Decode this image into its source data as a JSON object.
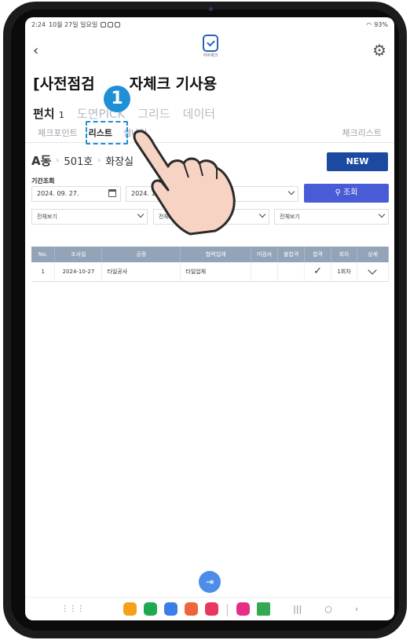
{
  "status": {
    "time": "2:24",
    "date": "10월 27일 일요일",
    "battery": "93%"
  },
  "app": {
    "logo_text": "하자체크",
    "title_visible": "[사전점검",
    "title_rest": "자체크 기사용"
  },
  "tabs_primary": [
    {
      "label": "펀치",
      "count": "1",
      "active": true
    },
    {
      "label": "도면PICK",
      "active": false
    },
    {
      "label": "그리드",
      "active": false
    },
    {
      "label": "데이터",
      "active": false
    }
  ],
  "tabs_secondary": {
    "items": [
      "체크포인트",
      "리스트",
      "썸네일"
    ],
    "active": "리스트",
    "right": "체크리스트"
  },
  "step_badge": "1",
  "breadcrumb": {
    "building": "A동",
    "unit": "501호",
    "room": "화장실"
  },
  "new_button": "NEW",
  "filters": {
    "period_label": "기간조회",
    "date_from": "2024. 09. 27.",
    "date_to": "2024. 10. 27.",
    "search_button": "조회",
    "dropdown_1": "전체보기",
    "dropdown_2": "전체보기",
    "dropdown_3": "전체보기"
  },
  "table": {
    "headers": [
      "No.",
      "조사일",
      "공종",
      "협력업체",
      "미검사",
      "불합격",
      "합격",
      "회차",
      "상세"
    ],
    "rows": [
      {
        "no": "1",
        "date": "2024-10-27",
        "trade": "타일공사",
        "partner": "타일업체",
        "uninspected": "",
        "fail": "",
        "pass": "✓",
        "round": "1회차"
      }
    ]
  },
  "colors": {
    "primary": "#1b4aa0",
    "accent": "#1f8fd6",
    "search": "#4a5bd6",
    "header": "#93a3b8"
  }
}
